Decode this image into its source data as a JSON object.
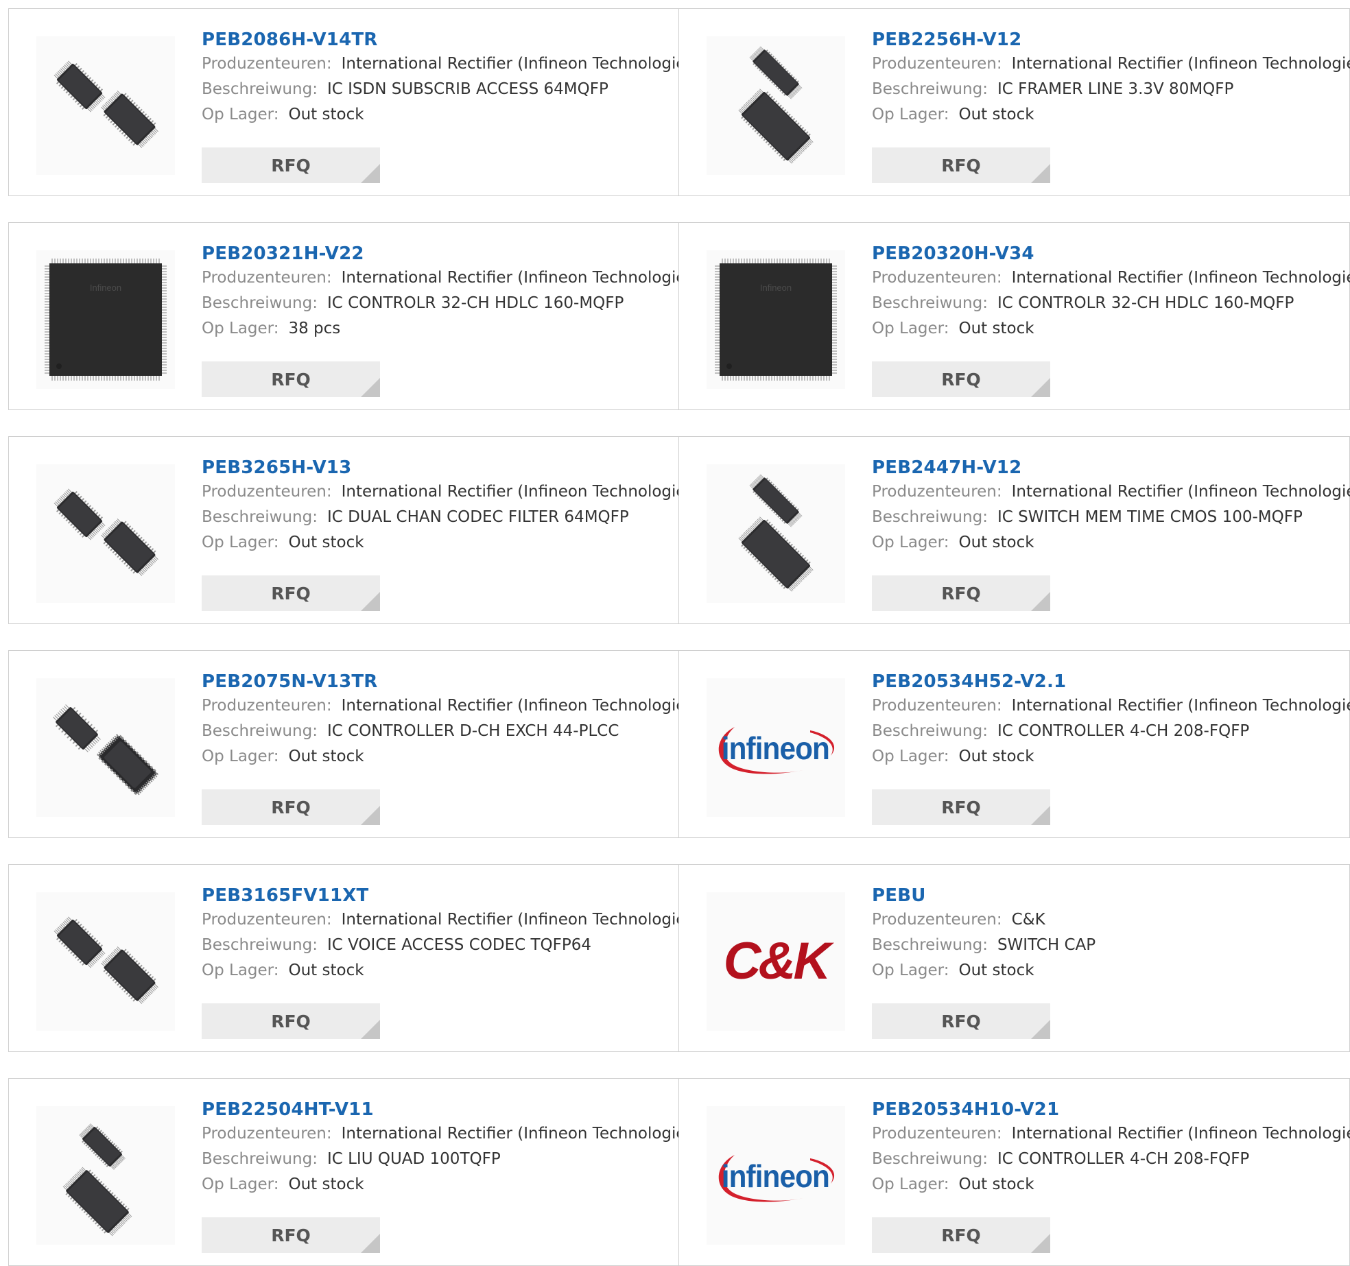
{
  "labels": {
    "manufacturer": "Produzenteuren:",
    "description": "Beschreiwung:",
    "stock": "Op Lager:",
    "rfq": "RFQ"
  },
  "products": [
    {
      "name": "PEB2086H-V14TR",
      "manufacturer": "International Rectifier (Infineon Technologies)",
      "description": "IC ISDN SUBSCRIB ACCESS 64MQFP",
      "stock": "Out stock",
      "image": "chip-pair-qfp-icon"
    },
    {
      "name": "PEB2256H-V12",
      "manufacturer": "International Rectifier (Infineon Technologies)",
      "description": "IC FRAMER LINE 3.3V 80MQFP",
      "stock": "Out stock",
      "image": "chip-stack-qfp-icon"
    },
    {
      "name": "PEB20321H-V22",
      "manufacturer": "International Rectifier (Infineon Technologies)",
      "description": "IC CONTROLR 32-CH HDLC 160-MQFP",
      "stock": "38 pcs",
      "image": "chip-large-qfp-icon"
    },
    {
      "name": "PEB20320H-V34",
      "manufacturer": "International Rectifier (Infineon Technologies)",
      "description": "IC CONTROLR 32-CH HDLC 160-MQFP",
      "stock": "Out stock",
      "image": "chip-large-qfp-icon"
    },
    {
      "name": "PEB3265H-V13",
      "manufacturer": "International Rectifier (Infineon Technologies)",
      "description": "IC DUAL CHAN CODEC FILTER 64MQFP",
      "stock": "Out stock",
      "image": "chip-pair-qfp-icon"
    },
    {
      "name": "PEB2447H-V12",
      "manufacturer": "International Rectifier (Infineon Technologies)",
      "description": "IC SWITCH MEM TIME CMOS 100-MQFP",
      "stock": "Out stock",
      "image": "chip-stack-qfp-icon"
    },
    {
      "name": "PEB2075N-V13TR",
      "manufacturer": "International Rectifier (Infineon Technologies)",
      "description": "IC CONTROLLER D-CH EXCH 44-PLCC",
      "stock": "Out stock",
      "image": "chip-pair-plcc-icon"
    },
    {
      "name": "PEB20534H52-V2.1",
      "manufacturer": "International Rectifier (Infineon Technologies)",
      "description": "IC CONTROLLER 4-CH 208-FQFP",
      "stock": "Out stock",
      "image": "infineon-logo"
    },
    {
      "name": "PEB3165FV11XT",
      "manufacturer": "International Rectifier (Infineon Technologies)",
      "description": "IC VOICE ACCESS CODEC TQFP64",
      "stock": "Out stock",
      "image": "chip-pair-qfp-icon"
    },
    {
      "name": "PEBU",
      "manufacturer": "C&K",
      "description": "SWITCH CAP",
      "stock": "Out stock",
      "image": "ck-logo"
    },
    {
      "name": "PEB22504HT-V11",
      "manufacturer": "International Rectifier (Infineon Technologies)",
      "description": "IC LIU QUAD 100TQFP",
      "stock": "Out stock",
      "image": "chip-pair-tqfp-icon"
    },
    {
      "name": "PEB20534H10-V21",
      "manufacturer": "International Rectifier (Infineon Technologies)",
      "description": "IC CONTROLLER 4-CH 208-FQFP",
      "stock": "Out stock",
      "image": "infineon-logo"
    }
  ],
  "logos": {
    "infineon": "infineon",
    "ck": "C&K",
    "chip_marking": "Infineon"
  },
  "colors": {
    "link": "#1a66b0",
    "label": "#8a8a8a",
    "value": "#333333",
    "button_bg": "#ececec",
    "border": "#cfcfcf",
    "infineon_red": "#d4202c",
    "infineon_blue": "#1a5fa8",
    "ck_red": "#b3111d"
  }
}
